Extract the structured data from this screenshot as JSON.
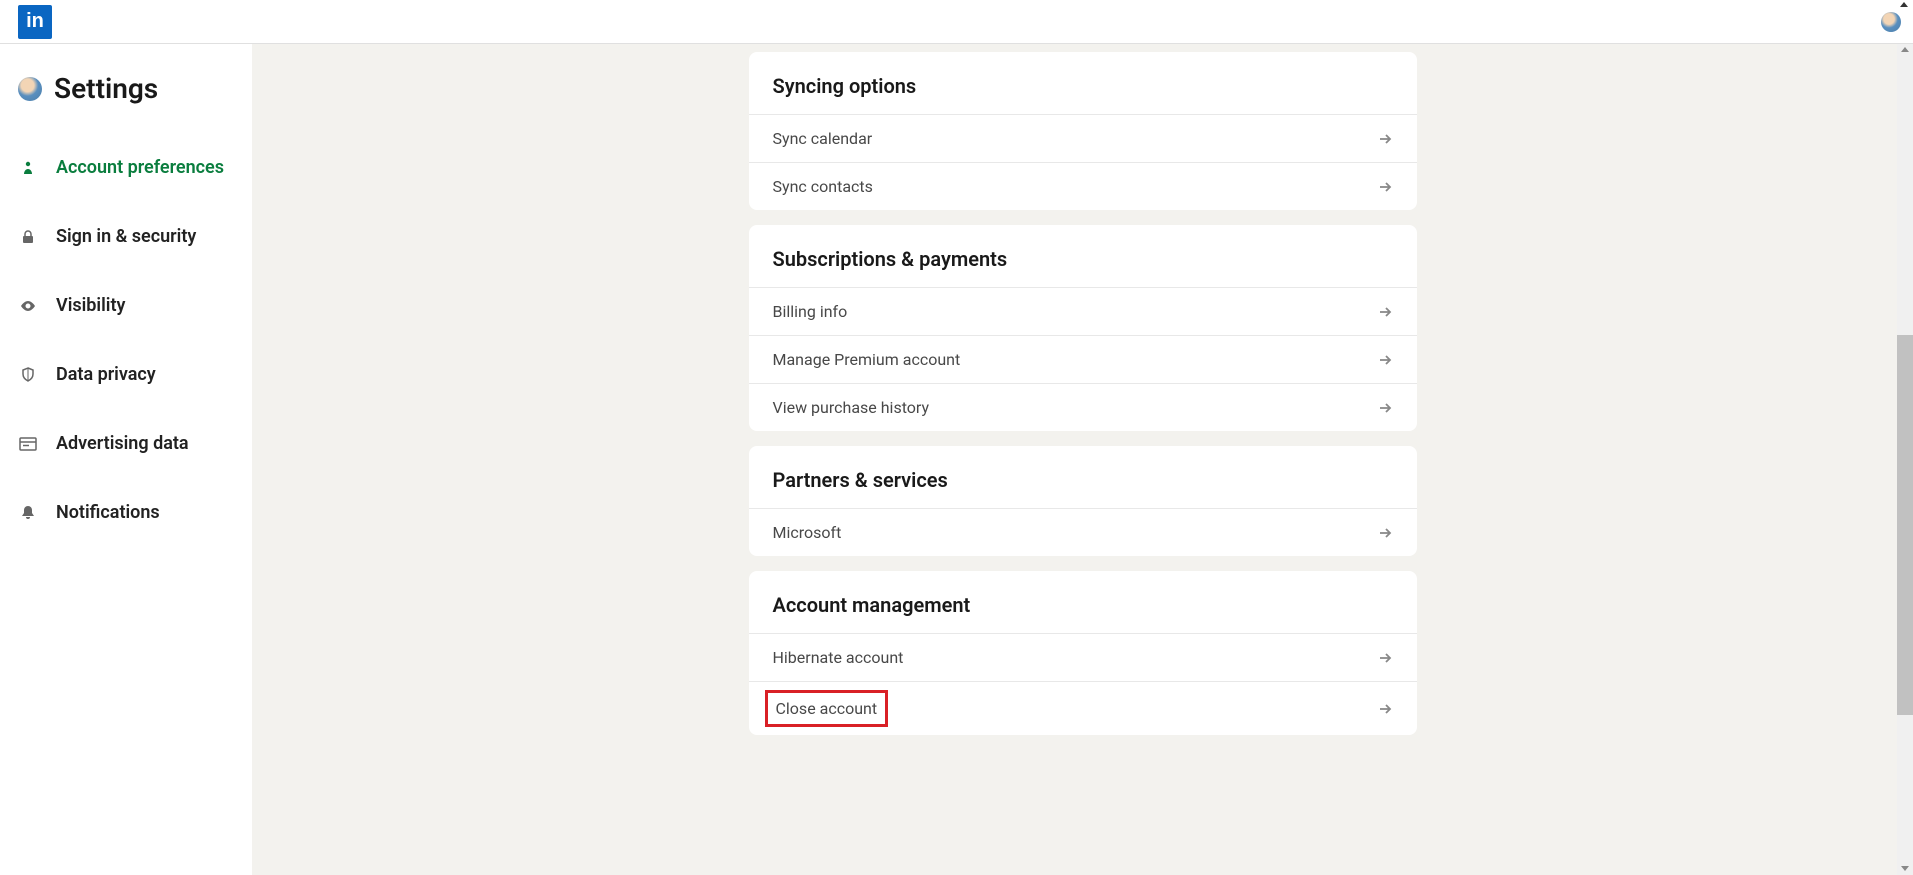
{
  "header": {
    "logo_text": "in"
  },
  "sidebar": {
    "title": "Settings",
    "items": [
      {
        "label": "Account preferences",
        "icon": "person-icon",
        "active": true
      },
      {
        "label": "Sign in & security",
        "icon": "lock-icon",
        "active": false
      },
      {
        "label": "Visibility",
        "icon": "eye-icon",
        "active": false
      },
      {
        "label": "Data privacy",
        "icon": "shield-icon",
        "active": false
      },
      {
        "label": "Advertising data",
        "icon": "ad-icon",
        "active": false
      },
      {
        "label": "Notifications",
        "icon": "bell-icon",
        "active": false
      }
    ]
  },
  "sections": [
    {
      "title": "Syncing options",
      "rows": [
        {
          "label": "Sync calendar"
        },
        {
          "label": "Sync contacts"
        }
      ]
    },
    {
      "title": "Subscriptions & payments",
      "rows": [
        {
          "label": "Billing info"
        },
        {
          "label": "Manage Premium account"
        },
        {
          "label": "View purchase history"
        }
      ]
    },
    {
      "title": "Partners & services",
      "rows": [
        {
          "label": "Microsoft"
        }
      ]
    },
    {
      "title": "Account management",
      "rows": [
        {
          "label": "Hibernate account"
        },
        {
          "label": "Close account",
          "highlight": true
        }
      ]
    }
  ]
}
